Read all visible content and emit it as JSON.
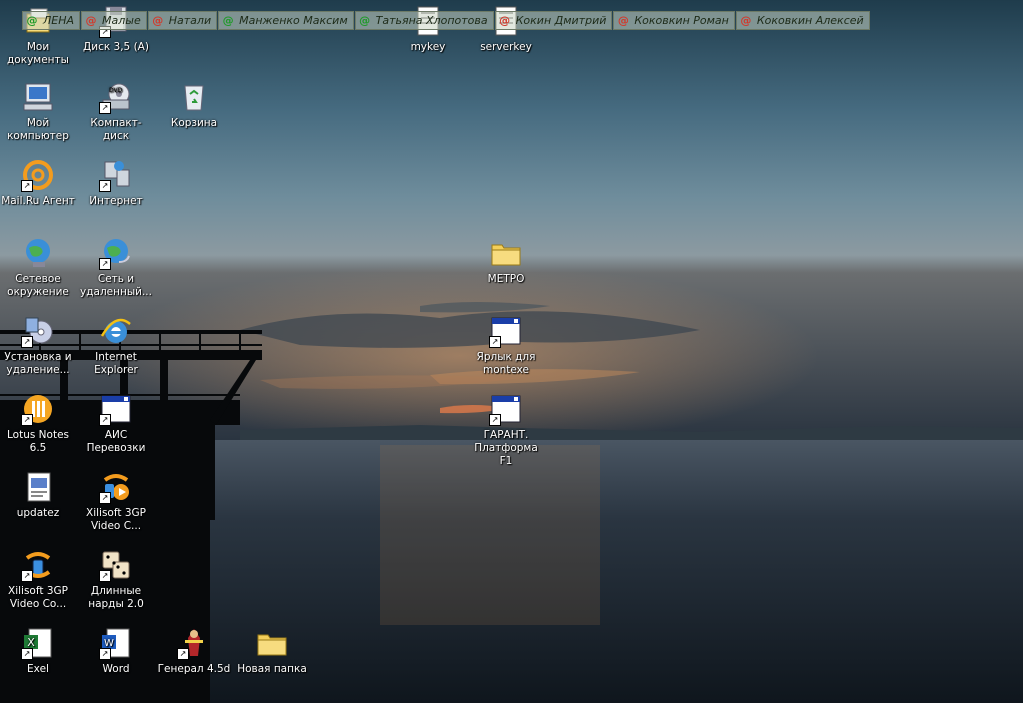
{
  "agent_contacts": [
    {
      "name": "ЛЕНА",
      "status": "online",
      "color": "#1f9a2a"
    },
    {
      "name": "Малые",
      "status": "offline",
      "color": "#d13a2d"
    },
    {
      "name": "Натали",
      "status": "offline",
      "color": "#d13a2d"
    },
    {
      "name": "Манженко Максим",
      "status": "online",
      "color": "#1f9a2a"
    },
    {
      "name": "Татьяна Хлопотова",
      "status": "online",
      "color": "#1f9a2a"
    },
    {
      "name": "Кокин Дмитрий",
      "status": "offline",
      "color": "#d13a2d"
    },
    {
      "name": "Коковкин Роман",
      "status": "offline",
      "color": "#d13a2d"
    },
    {
      "name": "Коковкин Алексей",
      "status": "offline",
      "color": "#d13a2d"
    }
  ],
  "desktop": {
    "col1": [
      {
        "label": "Мои документы",
        "icon": "my-documents-icon",
        "shortcut": false
      },
      {
        "label": "Мой компьютер",
        "icon": "my-computer-icon",
        "shortcut": false
      },
      {
        "label": "Mail.Ru Агент",
        "icon": "mailru-agent-icon",
        "shortcut": true
      },
      {
        "label": "Сетевое окружение",
        "icon": "network-places-icon",
        "shortcut": false
      },
      {
        "label": "Установка и удаление...",
        "icon": "add-remove-programs-icon",
        "shortcut": true
      },
      {
        "label": "Lotus Notes 6.5",
        "icon": "lotus-notes-icon",
        "shortcut": true
      },
      {
        "label": "updatez",
        "icon": "script-file-icon",
        "shortcut": false
      },
      {
        "label": "Xilisoft 3GP Video Co...",
        "icon": "xilisoft-converter-icon",
        "shortcut": true
      },
      {
        "label": "Exel",
        "icon": "excel-icon",
        "shortcut": true
      }
    ],
    "col2": [
      {
        "label": "Диск 3,5 (A)",
        "icon": "floppy-drive-icon",
        "shortcut": true
      },
      {
        "label": "Компакт-диск",
        "icon": "dvd-drive-icon",
        "shortcut": true
      },
      {
        "label": "Интернет",
        "icon": "internet-connection-icon",
        "shortcut": true
      },
      {
        "label": "Сеть и удаленный...",
        "icon": "network-connections-icon",
        "shortcut": true
      },
      {
        "label": "Internet Explorer",
        "icon": "internet-explorer-icon",
        "shortcut": false
      },
      {
        "label": "АИС Перевозки",
        "icon": "application-window-icon",
        "shortcut": true
      },
      {
        "label": "Xilisoft 3GP Video C...",
        "icon": "xilisoft-video-icon",
        "shortcut": true
      },
      {
        "label": "Длинные нарды 2.0",
        "icon": "backgammon-icon",
        "shortcut": true
      },
      {
        "label": "Word",
        "icon": "word-icon",
        "shortcut": true
      }
    ],
    "col3": [
      {
        "label": "Корзина",
        "icon": "recycle-bin-icon",
        "shortcut": false
      },
      {
        "label": "Генерал 4.5d",
        "icon": "general-game-icon",
        "shortcut": true
      }
    ],
    "col4": [
      {
        "label": "Новая папка",
        "icon": "folder-icon",
        "shortcut": false
      }
    ],
    "col6": [
      {
        "label": "mykey",
        "icon": "text-file-icon",
        "shortcut": false
      }
    ],
    "col7": [
      {
        "label": "serverkey",
        "icon": "text-file-icon",
        "shortcut": false
      },
      {
        "label": "МЕТРО",
        "icon": "folder-icon",
        "shortcut": false
      },
      {
        "label": "Ярлык для montexe",
        "icon": "application-window-icon",
        "shortcut": true
      },
      {
        "label": "ГАРАНТ. Платформа F1",
        "icon": "application-window-icon",
        "shortcut": true
      }
    ]
  }
}
